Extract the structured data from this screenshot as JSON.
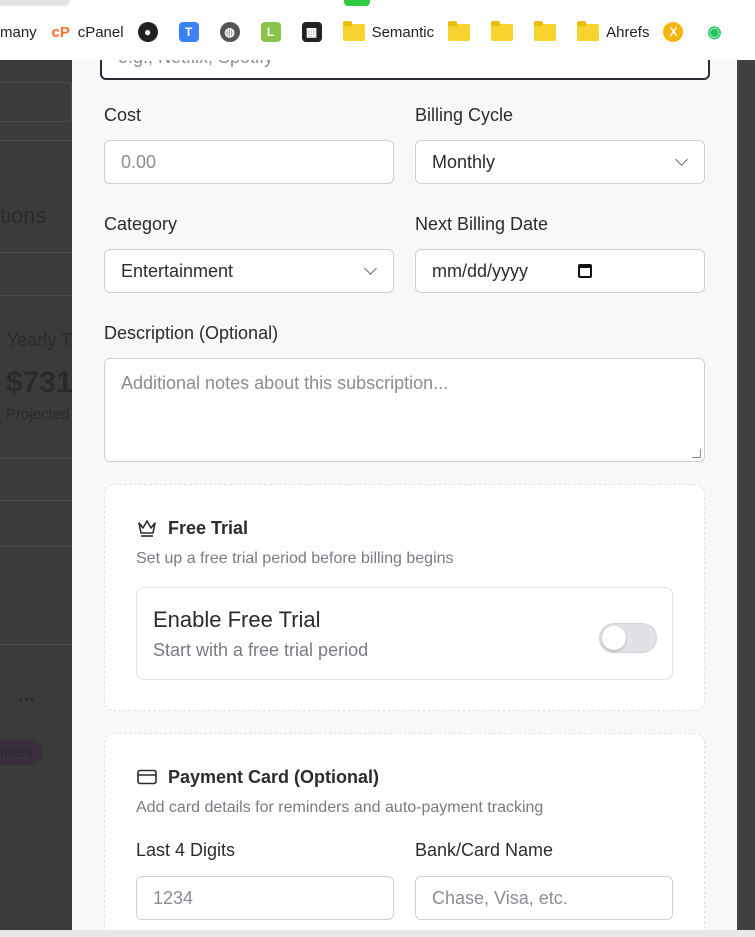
{
  "bookmarks": [
    {
      "label": "many",
      "icon": "partial-icon"
    },
    {
      "label": "cPanel",
      "icon": "cpanel-icon"
    },
    {
      "label": "",
      "icon": "spy-icon"
    },
    {
      "label": "",
      "icon": "t-icon"
    },
    {
      "label": "",
      "icon": "globe-icon"
    },
    {
      "label": "",
      "icon": "lh-icon"
    },
    {
      "label": "",
      "icon": "film-icon"
    },
    {
      "label": "Semantic",
      "icon": "folder-icon"
    },
    {
      "label": "",
      "icon": "folder-icon"
    },
    {
      "label": "",
      "icon": "folder-icon"
    },
    {
      "label": "",
      "icon": "folder-icon"
    },
    {
      "label": "Ahrefs",
      "icon": "folder-icon"
    },
    {
      "label": "",
      "icon": "x-icon"
    },
    {
      "label": "",
      "icon": "dot-icon"
    }
  ],
  "background": {
    "section_title": "tions",
    "stat_label": "Yearly T",
    "stat_value": "$731",
    "stat_sub": "Projected",
    "menu": "...",
    "tag": "ment"
  },
  "form": {
    "name_placeholder": "e.g., Netflix, Spotify",
    "cost": {
      "label": "Cost",
      "placeholder": "0.00"
    },
    "billing_cycle": {
      "label": "Billing Cycle",
      "value": "Monthly"
    },
    "category": {
      "label": "Category",
      "value": "Entertainment"
    },
    "next_billing": {
      "label": "Next Billing Date",
      "placeholder": "mm/dd/yyyy"
    },
    "description": {
      "label": "Description (Optional)",
      "placeholder": "Additional notes about this subscription..."
    },
    "free_trial": {
      "title": "Free Trial",
      "subtitle": "Set up a free trial period before billing begins",
      "toggle_title": "Enable Free Trial",
      "toggle_sub": "Start with a free trial period",
      "enabled": false
    },
    "payment_card": {
      "title": "Payment Card (Optional)",
      "subtitle": "Add card details for reminders and auto-payment tracking",
      "last4": {
        "label": "Last 4 Digits",
        "placeholder": "1234"
      },
      "bank": {
        "label": "Bank/Card Name",
        "placeholder": "Chase, Visa, etc."
      }
    }
  }
}
